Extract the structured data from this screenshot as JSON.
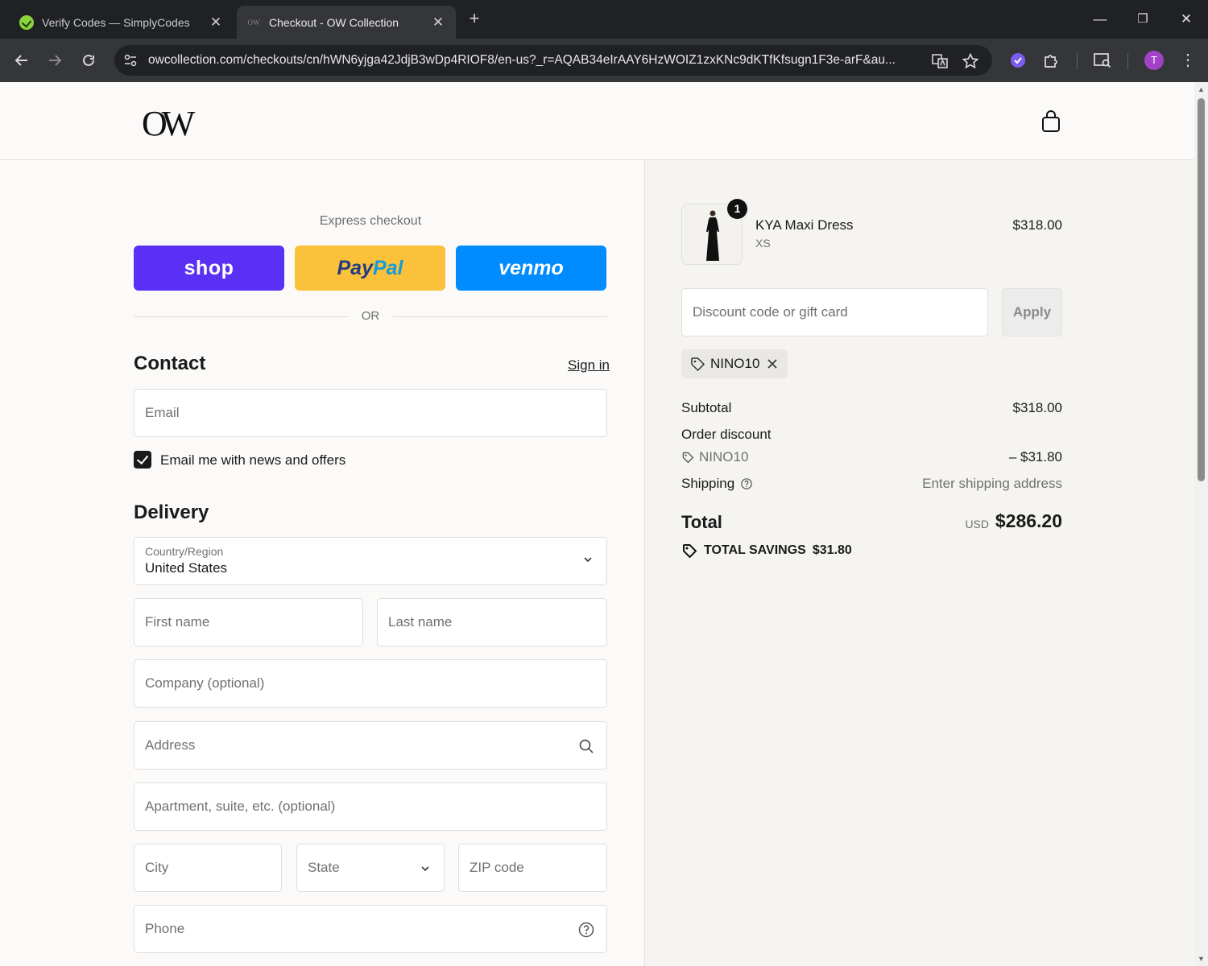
{
  "browser": {
    "tabs": [
      {
        "title": "Verify Codes — SimplyCodes",
        "close": "✕"
      },
      {
        "title": "Checkout - OW Collection",
        "favicon_text": "OW",
        "close": "✕"
      }
    ],
    "new_tab": "+",
    "url": "owcollection.com/checkouts/cn/hWN6yjga42JdjB3wDp4RIOF8/en-us?_r=AQAB34eIrAAY6HzWOIZ1zxKNc9dKTfKfsugn1F3e-arF&au...",
    "profile_initial": "T",
    "window_controls": {
      "minimize": "—",
      "restore": "❐",
      "close": "✕"
    }
  },
  "store": {
    "logo_text": "OW"
  },
  "express": {
    "title": "Express checkout",
    "shop_label": "shop",
    "paypal_label_a": "Pay",
    "paypal_label_b": "Pal",
    "venmo_label": "venmo",
    "or_text": "OR"
  },
  "contact": {
    "title": "Contact",
    "sign_in": "Sign in",
    "email_placeholder": "Email",
    "newsletter_label": "Email me with news and offers",
    "newsletter_checked": true
  },
  "delivery": {
    "title": "Delivery",
    "country_label": "Country/Region",
    "country_value": "United States",
    "first_name": "First name",
    "last_name": "Last name",
    "company": "Company (optional)",
    "address": "Address",
    "apartment": "Apartment, suite, etc. (optional)",
    "city": "City",
    "state": "State",
    "zip": "ZIP code",
    "phone": "Phone"
  },
  "summary": {
    "product": {
      "name": "KYA Maxi Dress",
      "variant": "XS",
      "price": "$318.00",
      "quantity": "1"
    },
    "discount_placeholder": "Discount code or gift card",
    "apply_label": "Apply",
    "applied_code": "NINO10",
    "subtotal_label": "Subtotal",
    "subtotal_value": "$318.00",
    "order_discount_label": "Order discount",
    "discount_code": "NINO10",
    "discount_value": "– $31.80",
    "shipping_label": "Shipping",
    "shipping_value": "Enter shipping address",
    "total_label": "Total",
    "total_currency": "USD",
    "total_value": "$286.20",
    "savings_label": "TOTAL SAVINGS",
    "savings_value": "$31.80"
  }
}
